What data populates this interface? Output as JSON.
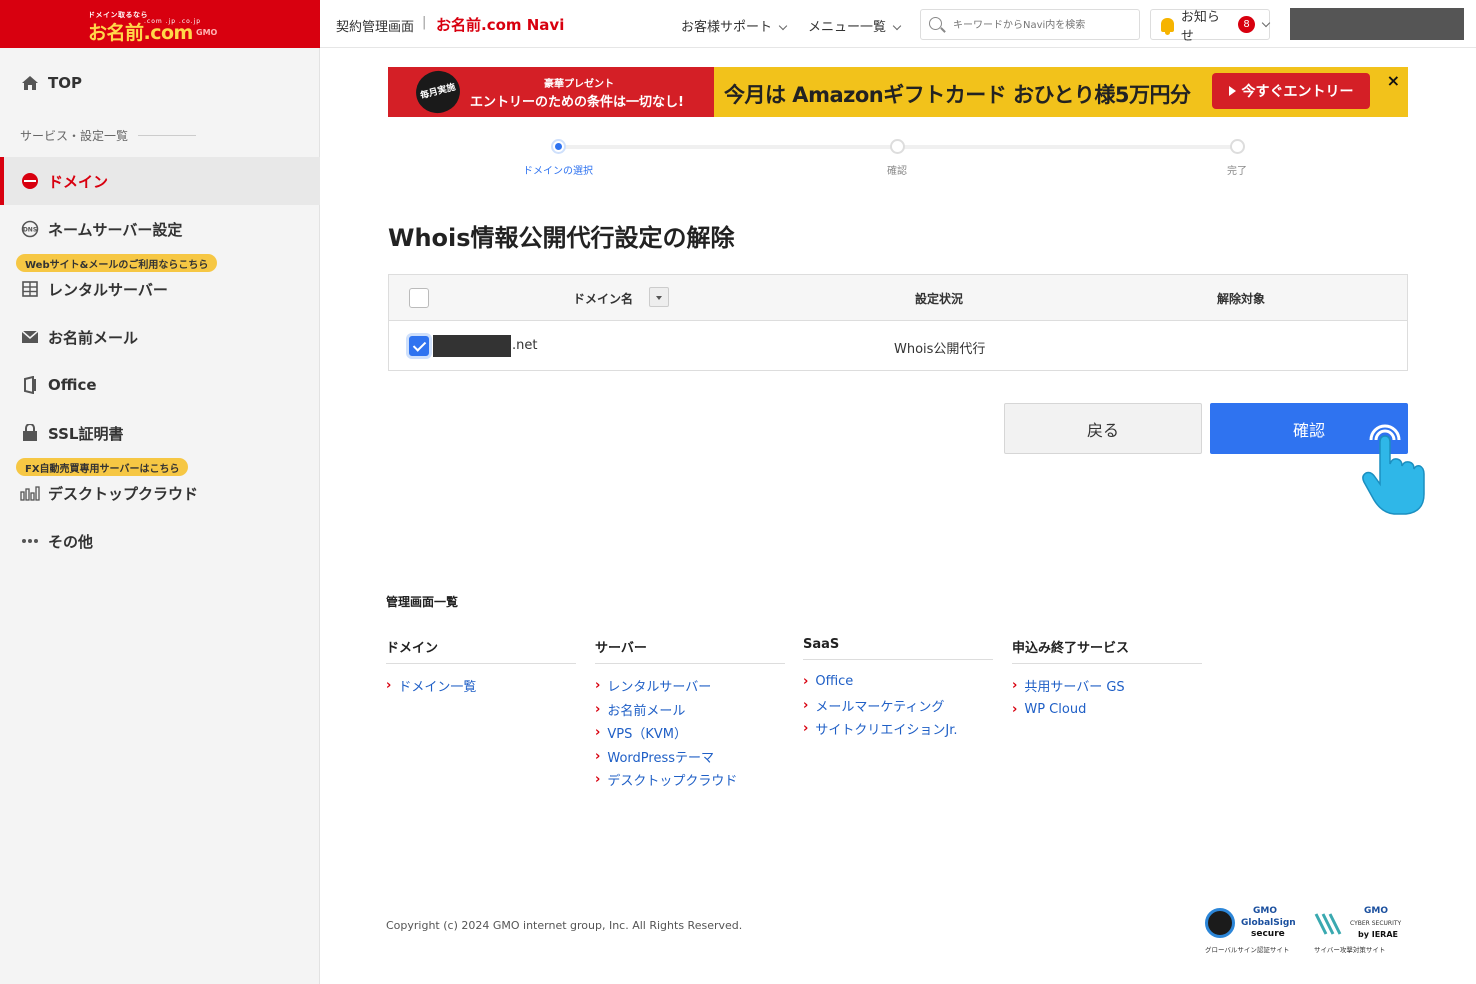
{
  "logo": {
    "tagline": "ドメイン取るなら",
    "main": "お名前.com",
    "sub": ".com .jp .co.jp",
    "gmo": "GMO"
  },
  "sidebar": {
    "top": "TOP",
    "section": "サービス・設定一覧",
    "items": [
      {
        "label": "ドメイン",
        "icon": "dotcom-icon"
      },
      {
        "label": "ネームサーバー設定",
        "icon": "dns-icon"
      },
      {
        "label": "レンタルサーバー",
        "icon": "server-icon"
      },
      {
        "label": "お名前メール",
        "icon": "mail-icon"
      },
      {
        "label": "Office",
        "icon": "office-icon"
      },
      {
        "label": "SSL証明書",
        "icon": "lock-icon"
      },
      {
        "label": "デスクトップクラウド",
        "icon": "chart-icon"
      },
      {
        "label": "その他",
        "icon": "more-icon"
      }
    ],
    "promo_web": "Webサイト&メールのご利用ならこちら",
    "promo_fx": "FX自動売買専用サーバーはこちら"
  },
  "header": {
    "title": "契約管理画面",
    "sep": "|",
    "navi": "お名前.com Navi",
    "support": "お客様サポート",
    "menu": "メニュー一覧",
    "search_placeholder": "キーワードからNavi内を検索",
    "notice": "お知らせ",
    "notice_count": "8"
  },
  "banner": {
    "roundel": "毎月実施",
    "sub1": "豪華プレゼント",
    "sub2": "エントリーのための条件は一切なし!",
    "main": "今月は Amazonギフトカード おひとり様5万円分",
    "cta": "今すぐエントリー",
    "close": "×"
  },
  "stepper": {
    "steps": [
      "ドメインの選択",
      "確認",
      "完了"
    ],
    "current": 0
  },
  "page_title": "Whois情報公開代行設定の解除",
  "table": {
    "headers": {
      "domain": "ドメイン名",
      "status": "設定状況",
      "target": "解除対象"
    },
    "rows": [
      {
        "domain_suffix": ".net",
        "status": "Whois公開代行",
        "checked": true
      }
    ]
  },
  "buttons": {
    "back": "戻る",
    "confirm": "確認"
  },
  "footer": {
    "title": "管理画面一覧",
    "columns": [
      {
        "heading": "ドメイン",
        "links": [
          "ドメイン一覧"
        ]
      },
      {
        "heading": "サーバー",
        "links": [
          "レンタルサーバー",
          "お名前メール",
          "VPS（KVM）",
          "WordPressテーマ",
          "デスクトップクラウド"
        ]
      },
      {
        "heading": "SaaS",
        "links": [
          "Office",
          "メールマーケティング",
          "サイトクリエイションJr."
        ]
      },
      {
        "heading": "申込み終了サービス",
        "links": [
          "共用サーバー GS",
          "WP Cloud"
        ]
      }
    ],
    "copyright": "Copyright (c) 2024 GMO internet group, Inc. All Rights Reserved.",
    "seal1": {
      "brand": "GMO",
      "name": "GlobalSign",
      "secure": "secure",
      "caption": "グローバルサイン認証サイト"
    },
    "seal2": {
      "brand": "GMO",
      "name": "CYBER SECURITY",
      "by": "by IERAE",
      "caption": "サイバー攻撃対策サイト"
    }
  },
  "colors": {
    "brand_red": "#d8000f",
    "accent_blue": "#2f73f0",
    "promo_yellow": "#f6c744"
  }
}
